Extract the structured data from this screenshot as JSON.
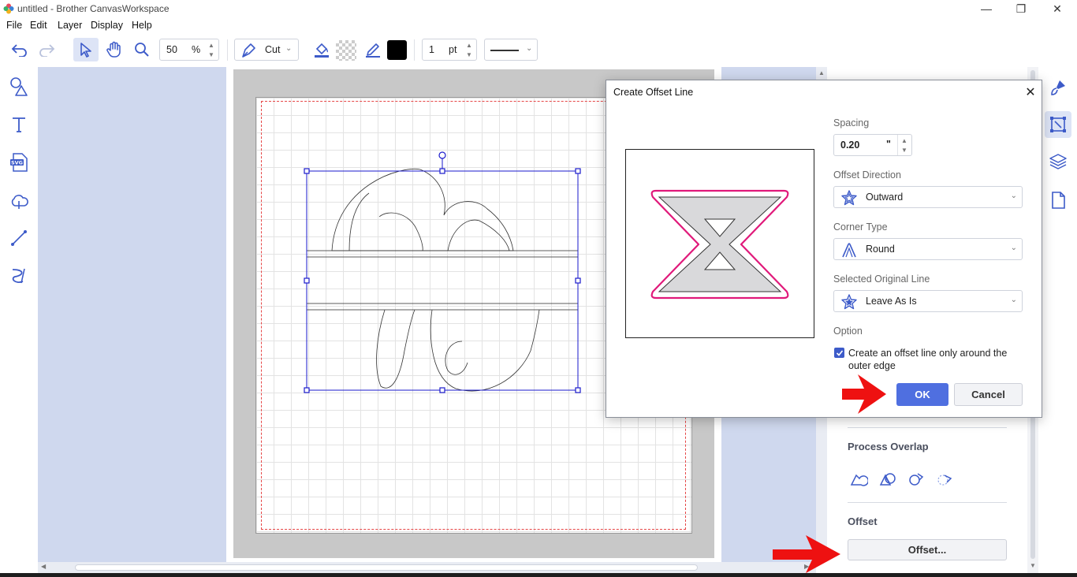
{
  "window": {
    "title": "untitled - Brother CanvasWorkspace",
    "controls": [
      "—",
      "❐",
      "✕"
    ]
  },
  "menu": [
    "File",
    "Edit",
    "Layer",
    "Display",
    "Help"
  ],
  "toolbar": {
    "zoom_value": "50",
    "zoom_unit": "%",
    "mode": "Cut",
    "line_width_value": "1",
    "line_width_unit": "pt",
    "fill_color": "#000000"
  },
  "right_panel": {
    "process_overlap_title": "Process Overlap",
    "offset_title": "Offset",
    "offset_button": "Offset..."
  },
  "dialog": {
    "title": "Create Offset Line",
    "close": "✕",
    "spacing_label": "Spacing",
    "spacing_value": "0.20",
    "spacing_unit": "\"",
    "direction_label": "Offset Direction",
    "direction_value": "Outward",
    "corner_label": "Corner Type",
    "corner_value": "Round",
    "original_label": "Selected Original Line",
    "original_value": "Leave As Is",
    "option_label": "Option",
    "option_text_1": "Create an offset line only around the",
    "option_text_2": "outer edge",
    "option_checked": true,
    "ok": "OK",
    "cancel": "Cancel"
  },
  "colors": {
    "accent": "#4f6fe0",
    "offset_line": "#e0197a",
    "arrow": "#ee1111",
    "selection": "#1a1acc"
  }
}
